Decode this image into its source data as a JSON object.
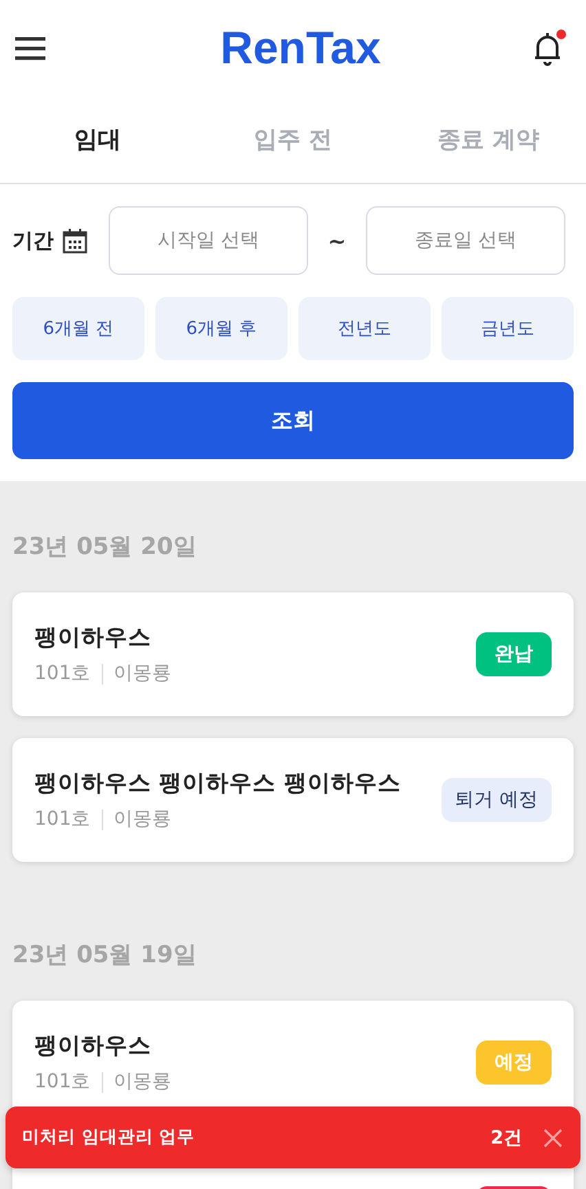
{
  "header": {
    "logo": "RenTax",
    "has_notification": true
  },
  "tabs": [
    {
      "label": "임대",
      "selected": true
    },
    {
      "label": "입주 전",
      "selected": false
    },
    {
      "label": "종료 계약",
      "selected": false
    }
  ],
  "filter": {
    "label": "기간",
    "start": {
      "placeholder": "시작일 선택"
    },
    "separator": "~",
    "end": {
      "placeholder": "종료일 선택"
    },
    "presets": [
      "6개월 전",
      "6개월 후",
      "전년도",
      "금년도"
    ],
    "search_button": "조회"
  },
  "groups": [
    {
      "date": "23년 05월 20일",
      "items": [
        {
          "title": "팽이하우스",
          "unit": "101호",
          "tenant": "이몽룡",
          "status": {
            "kind": "paid",
            "label": "완납"
          }
        },
        {
          "title": "팽이하우스 팽이하우스 팽이하우스",
          "unit": "101호",
          "tenant": "이몽룡",
          "status": {
            "kind": "moving-out",
            "label": "퇴거 예정"
          }
        }
      ]
    },
    {
      "date": "23년 05월 19일",
      "items": [
        {
          "title": "팽이하우스",
          "unit": "101호",
          "tenant": "이몽룡",
          "status": {
            "kind": "scheduled",
            "label": "예정"
          }
        },
        {
          "status": {
            "kind": "overdue"
          }
        }
      ]
    }
  ],
  "toast": {
    "message": "미처리 임대관리 업무",
    "count": "2건"
  }
}
